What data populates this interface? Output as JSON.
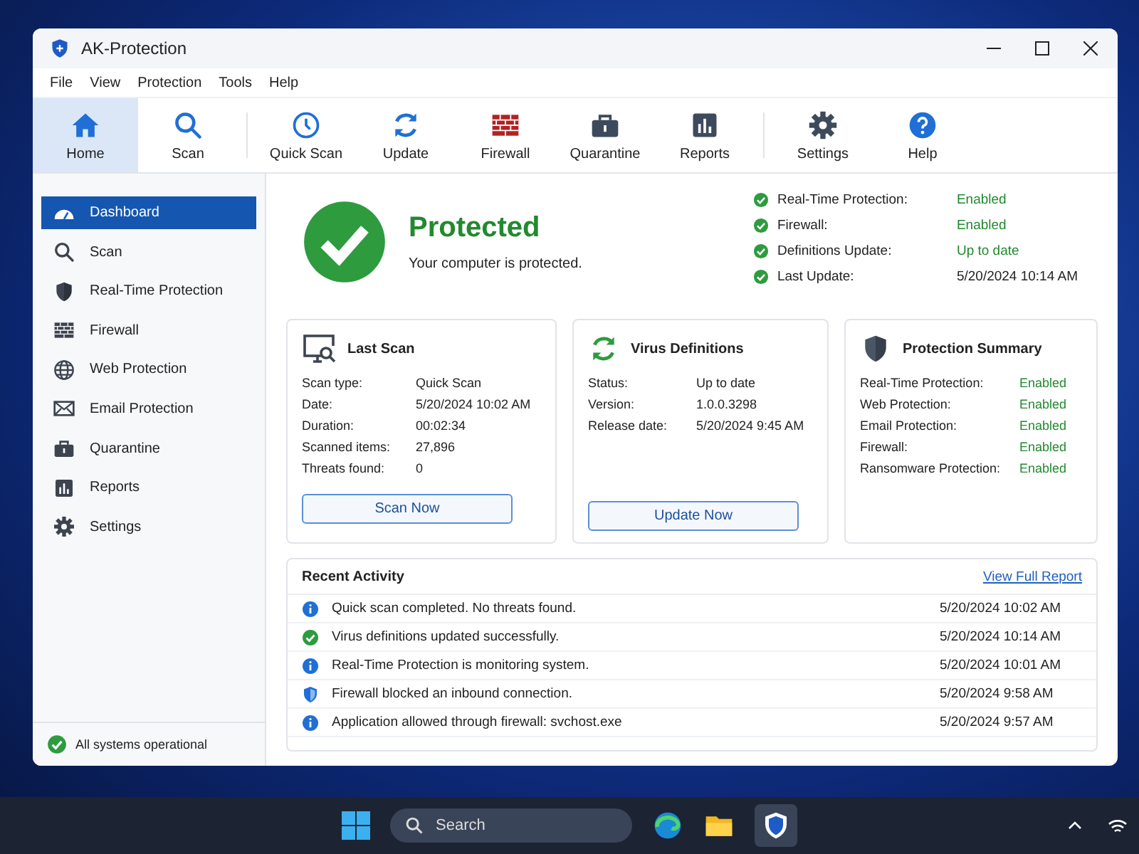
{
  "window": {
    "title": "AK-Protection"
  },
  "menu": [
    "File",
    "View",
    "Protection",
    "Tools",
    "Help"
  ],
  "toolbar": [
    [
      {
        "label": "Home",
        "selected": true
      },
      {
        "label": "Scan",
        "selected": false
      }
    ],
    [
      {
        "label": "Quick Scan",
        "selected": false
      },
      {
        "label": "Update",
        "selected": false
      },
      {
        "label": "Firewall",
        "selected": false
      },
      {
        "label": "Quarantine",
        "selected": false
      },
      {
        "label": "Reports",
        "selected": false
      }
    ],
    [
      {
        "label": "Settings",
        "selected": false
      },
      {
        "label": "Help",
        "selected": false
      }
    ]
  ],
  "sidebar": {
    "items": [
      {
        "label": "Dashboard",
        "selected": true
      },
      {
        "label": "Scan",
        "selected": false
      },
      {
        "label": "Real-Time Protection",
        "selected": false
      },
      {
        "label": "Firewall",
        "selected": false
      },
      {
        "label": "Web Protection",
        "selected": false
      },
      {
        "label": "Email Protection",
        "selected": false
      },
      {
        "label": "Quarantine",
        "selected": false
      },
      {
        "label": "Reports",
        "selected": false
      },
      {
        "label": "Settings",
        "selected": false
      }
    ],
    "status": "All systems operational"
  },
  "hero": {
    "title": "Protected",
    "subtitle": "Your computer is protected."
  },
  "status_list": [
    {
      "label": "Real-Time Protection:",
      "value": "Enabled",
      "ok": true
    },
    {
      "label": "Firewall:",
      "value": "Enabled",
      "ok": true
    },
    {
      "label": "Definitions Update:",
      "value": "Up to date",
      "ok": true
    },
    {
      "label": "Last Update:",
      "value": "5/20/2024 10:14 AM",
      "ok": false
    }
  ],
  "last_scan": {
    "title": "Last Scan",
    "rows": [
      [
        "Scan type:",
        "Quick Scan"
      ],
      [
        "Date:",
        "5/20/2024 10:02 AM"
      ],
      [
        "Duration:",
        "00:02:34"
      ],
      [
        "Scanned items:",
        "27,896"
      ],
      [
        "Threats found:",
        "0"
      ]
    ],
    "button": "Scan Now"
  },
  "virus_definitions": {
    "title": "Virus Definitions",
    "rows": [
      [
        "Status:",
        "Up to date"
      ],
      [
        "Version:",
        "1.0.0.3298"
      ],
      [
        "Release date:",
        "5/20/2024 9:45 AM"
      ]
    ],
    "button": "Update Now"
  },
  "protection_summary": {
    "title": "Protection Summary",
    "rows": [
      [
        "Real-Time Protection:",
        "Enabled"
      ],
      [
        "Web Protection:",
        "Enabled"
      ],
      [
        "Email Protection:",
        "Enabled"
      ],
      [
        "Firewall:",
        "Enabled"
      ],
      [
        "Ransomware Protection:",
        "Enabled"
      ]
    ]
  },
  "recent_activity": {
    "title": "Recent Activity",
    "link": "View Full Report",
    "rows": [
      {
        "kind": "info",
        "text": "Quick scan completed. No threats found.",
        "time": "5/20/2024 10:02 AM"
      },
      {
        "kind": "success",
        "text": "Virus definitions updated successfully.",
        "time": "5/20/2024 10:14 AM"
      },
      {
        "kind": "info",
        "text": "Real-Time Protection is monitoring system.",
        "time": "5/20/2024 10:01 AM"
      },
      {
        "kind": "shield",
        "text": "Firewall blocked an inbound connection.",
        "time": "5/20/2024 9:58 AM"
      },
      {
        "kind": "info",
        "text": "Application allowed through firewall: svchost.exe",
        "time": "5/20/2024 9:57 AM"
      }
    ]
  },
  "taskbar": {
    "search_placeholder": "Search"
  }
}
